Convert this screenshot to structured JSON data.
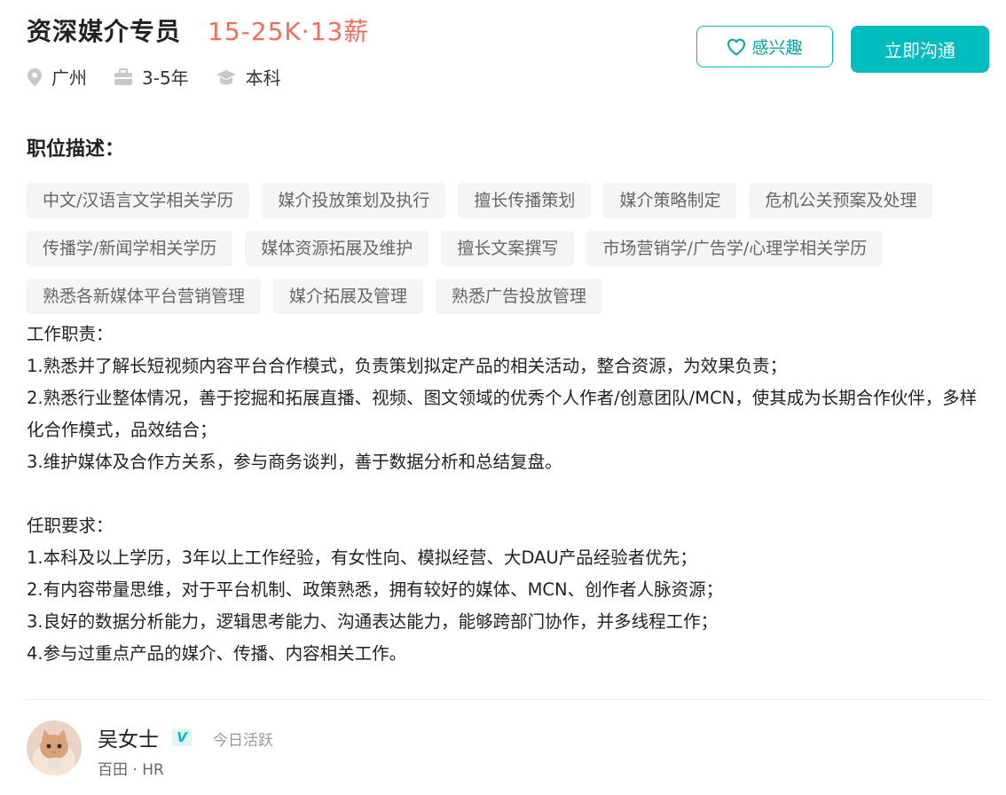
{
  "job": {
    "title": "资深媒介专员",
    "salary": "15-25K·13薪",
    "city": "广州",
    "experience": "3-5年",
    "education": "本科"
  },
  "actions": {
    "favorite_label": "感兴趣",
    "chat_label": "立即沟通"
  },
  "section_title": "职位描述：",
  "tags": [
    [
      "中文/汉语言文学相关学历",
      "媒介投放策划及执行",
      "擅长传播策划",
      "媒介策略制定",
      "危机公关预案及处理"
    ],
    [
      "传播学/新闻学相关学历",
      "媒体资源拓展及维护",
      "擅长文案撰写",
      "市场营销学/广告学/心理学相关学历"
    ],
    [
      "熟悉各新媒体平台营销管理",
      "媒介拓展及管理",
      "熟悉广告投放管理"
    ]
  ],
  "description": {
    "duties_title": "工作职责：",
    "duties": [
      "1.熟悉并了解长短视频内容平台合作模式，负责策划拟定产品的相关活动，整合资源，为效果负责；",
      "2.熟悉行业整体情况，善于挖掘和拓展直播、视频、图文领域的优秀个人作者/创意团队/MCN，使其成为长期合作伙伴，多样化合作模式，品效结合；",
      "3.维护媒体及合作方关系，参与商务谈判，善于数据分析和总结复盘。"
    ],
    "requirements_title": "任职要求：",
    "requirements": [
      "1.本科及以上学历，3年以上工作经验，有女性向、模拟经营、大DAU产品经验者优先；",
      "2.有内容带量思维，对于平台机制、政策熟悉，拥有较好的媒体、MCN、创作者人脉资源；",
      "3.良好的数据分析能力，逻辑思考能力、沟通表达能力，能够跨部门协作，并多线程工作；",
      "4.参与过重点产品的媒介、传播、内容相关工作。"
    ]
  },
  "recruiter": {
    "name": "吴女士",
    "verified_mark": "V",
    "status": "今日活跃",
    "company": "百田 · HR"
  },
  "colors": {
    "accent": "#00bebd",
    "salary": "#f26d5b",
    "tag_bg": "#f5f5f6"
  },
  "icons": {
    "location": "location-pin-icon",
    "experience": "briefcase-icon",
    "education": "graduation-cap-icon",
    "favorite": "heart-icon"
  }
}
